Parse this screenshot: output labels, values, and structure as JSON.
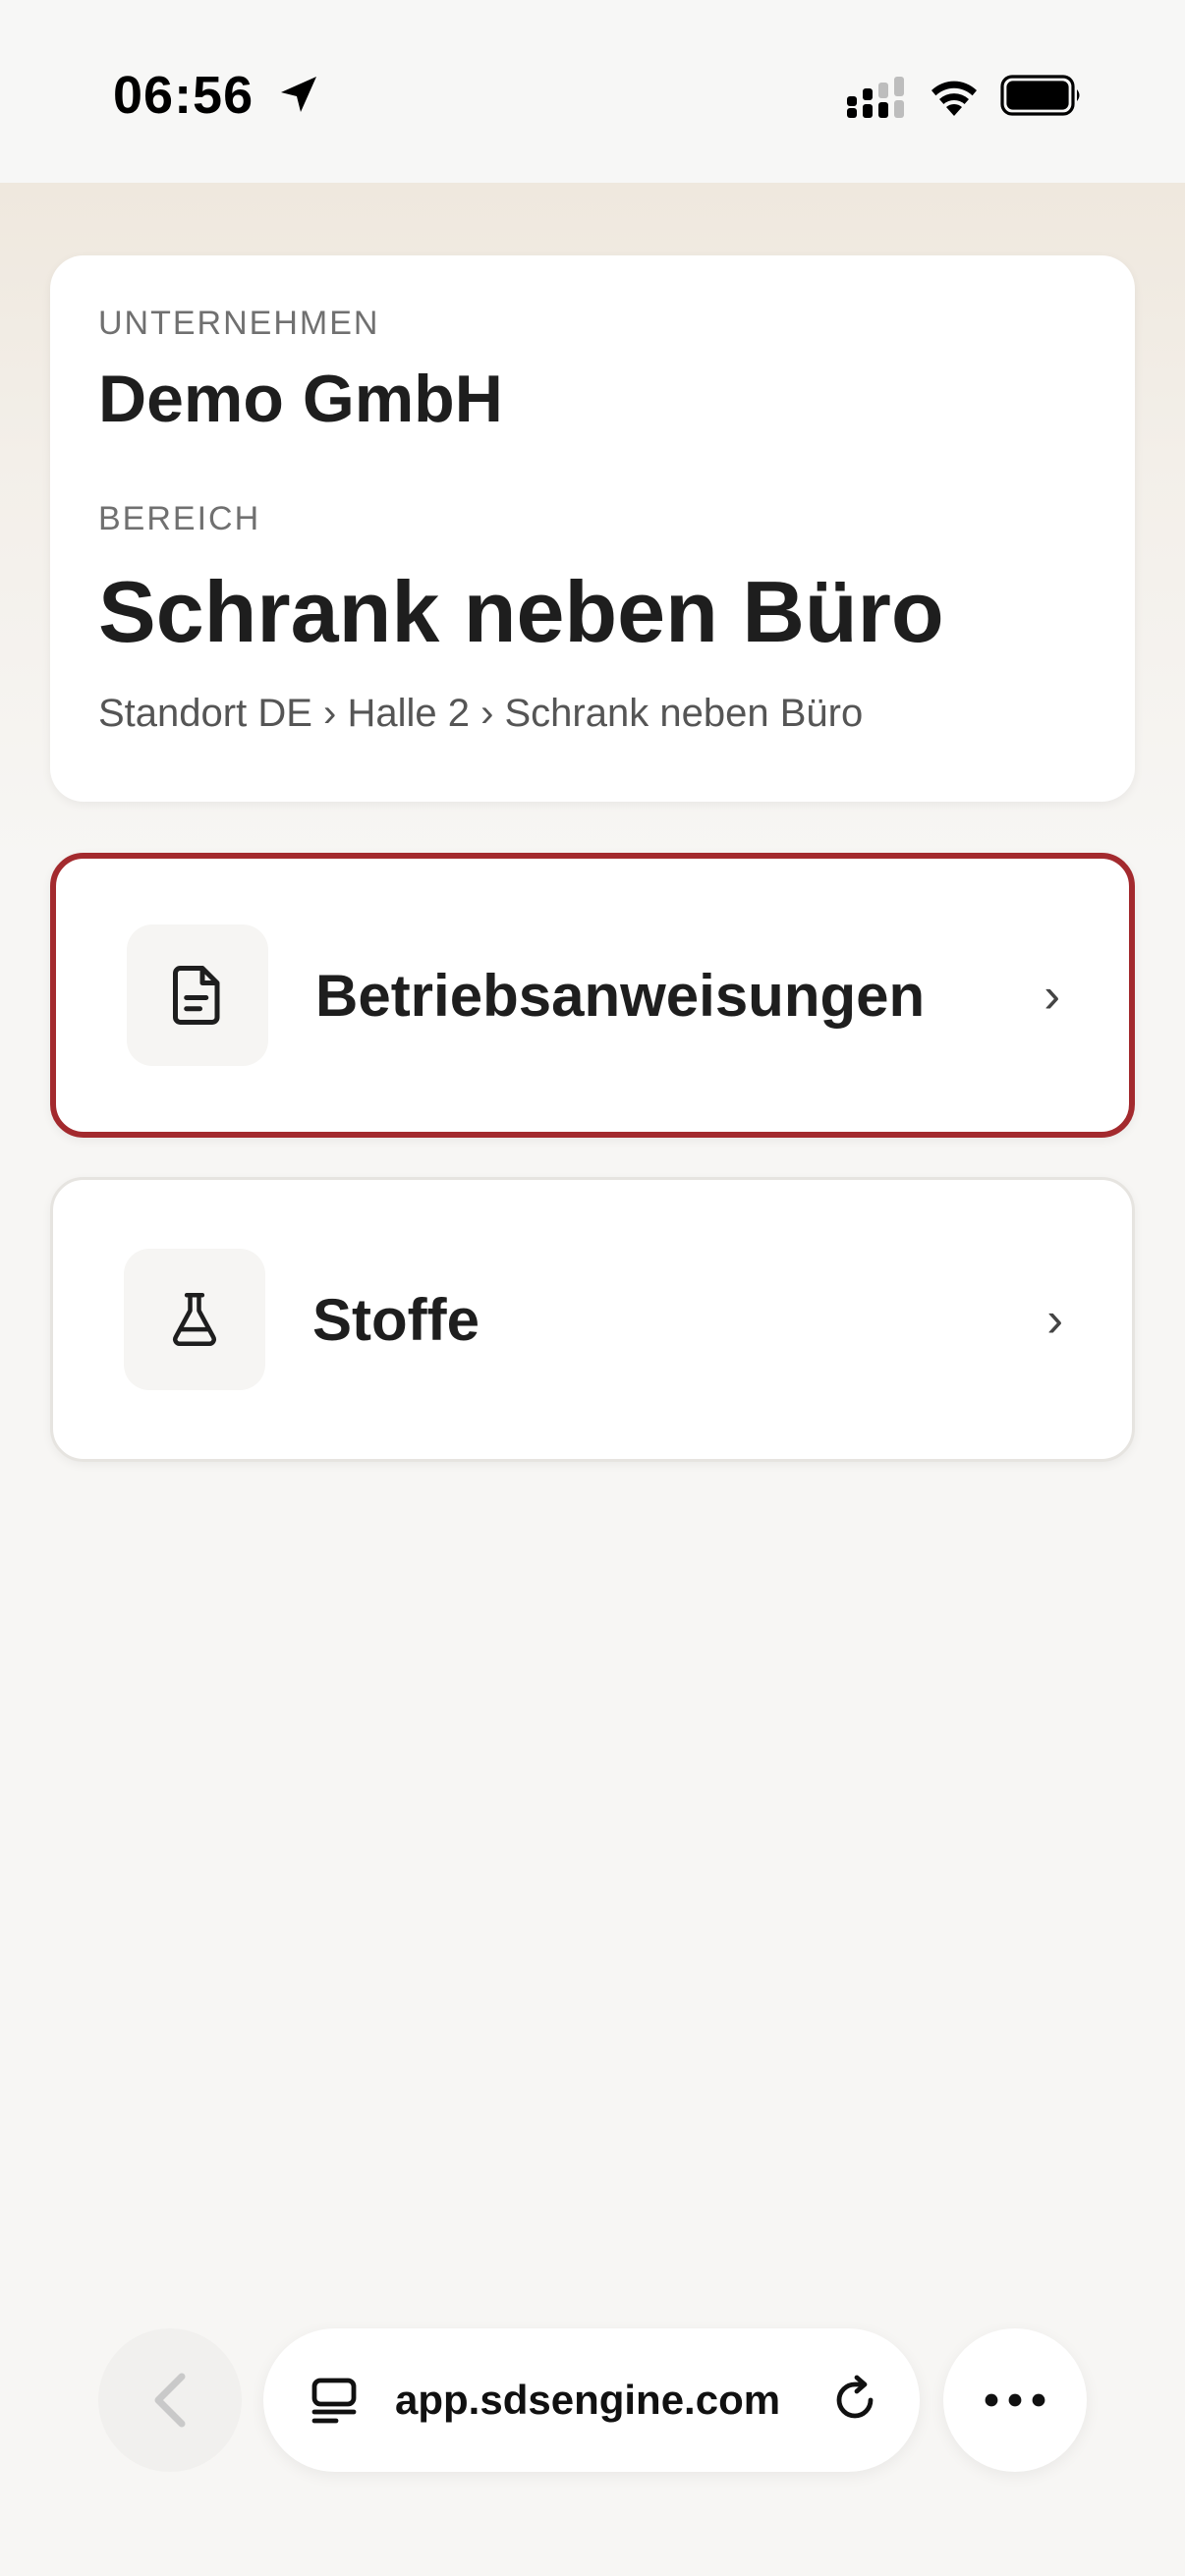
{
  "status_bar": {
    "time": "06:56",
    "icons": [
      "location-arrow-icon",
      "cellular-signal-icon",
      "wifi-icon",
      "battery-icon"
    ]
  },
  "info_card": {
    "company_label": "UNTERNEHMEN",
    "company_name": "Demo GmbH",
    "area_label": "BEREICH",
    "area_name": "Schrank neben Büro",
    "breadcrumb": "Standort DE › Halle 2 › Schrank neben Büro"
  },
  "nav_items": [
    {
      "label": "Betriebsanweisungen",
      "icon": "document-icon",
      "chevron": "›",
      "selected": true
    },
    {
      "label": "Stoffe",
      "icon": "flask-icon",
      "chevron": "›",
      "selected": false
    }
  ],
  "browser_bar": {
    "url": "app.sdsengine.com",
    "icons": [
      "back-chevron-icon",
      "page-tab-icon",
      "reload-icon",
      "more-icon"
    ]
  },
  "colors": {
    "accent_border": "#a32a2e",
    "background": "#f7f6f4",
    "card": "#ffffff"
  }
}
